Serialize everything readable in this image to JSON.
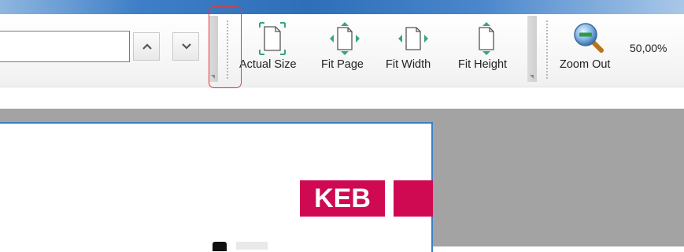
{
  "search": {
    "value": "",
    "placeholder": ""
  },
  "nav": {
    "prev_icon": "chevron-up-icon",
    "next_icon": "chevron-down-icon"
  },
  "tools": {
    "actual_size": "Actual Size",
    "fit_page": "Fit Page",
    "fit_width": "Fit Width",
    "fit_height": "Fit Height",
    "zoom_out": "Zoom Out"
  },
  "zoom": {
    "value": "50,00%"
  },
  "document": {
    "logo_text": "KEB"
  },
  "colors": {
    "accent": "#2d6fb8",
    "icon_green": "#3aa57a",
    "logo": "#cf0a52",
    "highlight": "#e03c3c"
  }
}
